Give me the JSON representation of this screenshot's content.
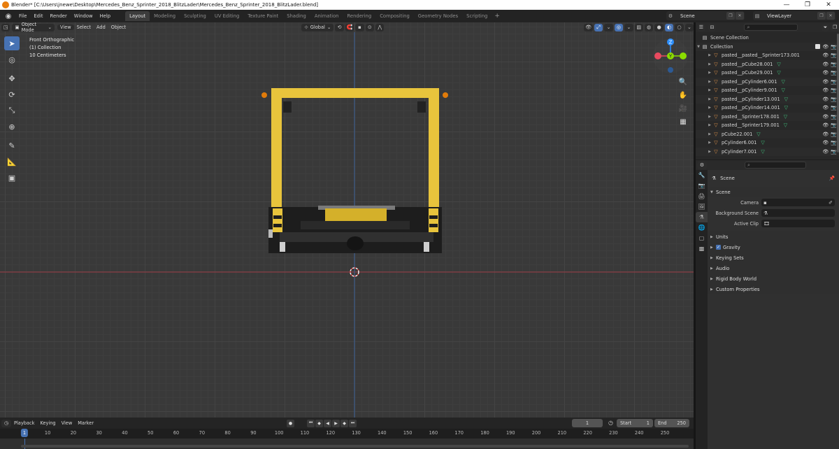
{
  "window": {
    "title": "Blender* [C:\\Users\\jnewe\\Desktop\\Mercedes_Benz_Sprinter_2018_BlitzLader\\Mercedes_Benz_Sprinter_2018_BlitzLader.blend]",
    "minimize": "—",
    "maximize": "❐",
    "close": "✕"
  },
  "menu": [
    "File",
    "Edit",
    "Render",
    "Window",
    "Help"
  ],
  "workspaces": [
    {
      "label": "Layout",
      "active": true
    },
    {
      "label": "Modeling",
      "active": false
    },
    {
      "label": "Sculpting",
      "active": false
    },
    {
      "label": "UV Editing",
      "active": false
    },
    {
      "label": "Texture Paint",
      "active": false
    },
    {
      "label": "Shading",
      "active": false
    },
    {
      "label": "Animation",
      "active": false
    },
    {
      "label": "Rendering",
      "active": false
    },
    {
      "label": "Compositing",
      "active": false
    },
    {
      "label": "Geometry Nodes",
      "active": false
    },
    {
      "label": "Scripting",
      "active": false
    }
  ],
  "workspace_add": "+",
  "scene_selector": {
    "value": "Scene"
  },
  "viewlayer_selector": {
    "value": "ViewLayer"
  },
  "viewport": {
    "mode": "Object Mode",
    "menus": [
      "View",
      "Select",
      "Add",
      "Object"
    ],
    "transform_orientation": "Global",
    "info_lines": [
      "Front Orthographic",
      "(1) Collection",
      "10 Centimeters"
    ],
    "gizmo_axes": {
      "x": "X",
      "y": "Y",
      "z": "Z"
    }
  },
  "outliner": {
    "search_placeholder": "",
    "scene_collection": "Scene Collection",
    "collection": "Collection",
    "items": [
      {
        "name": "pasted__pasted__Sprinter173.001",
        "modifier": false
      },
      {
        "name": "pasted__pCube28.001",
        "modifier": true
      },
      {
        "name": "pasted__pCube29.001",
        "modifier": true
      },
      {
        "name": "pasted__pCylinder6.001",
        "modifier": true
      },
      {
        "name": "pasted__pCylinder9.001",
        "modifier": true
      },
      {
        "name": "pasted__pCylinder13.001",
        "modifier": true
      },
      {
        "name": "pasted__pCylinder14.001",
        "modifier": true
      },
      {
        "name": "pasted__Sprinter178.001",
        "modifier": true
      },
      {
        "name": "pasted__Sprinter179.001",
        "modifier": true
      },
      {
        "name": "pCube22.001",
        "modifier": true
      },
      {
        "name": "pCylinder6.001",
        "modifier": true
      },
      {
        "name": "pCylinder7.001",
        "modifier": true
      }
    ]
  },
  "properties": {
    "breadcrumb": "Scene",
    "panel_scene": "Scene",
    "fields": [
      {
        "label": "Camera",
        "value": ""
      },
      {
        "label": "Background Scene",
        "value": ""
      },
      {
        "label": "Active Clip",
        "value": ""
      }
    ],
    "subpanels": [
      "Units",
      "Gravity",
      "Keying Sets",
      "Audio",
      "Rigid Body World",
      "Custom Properties"
    ],
    "gravity_enabled": true
  },
  "timeline": {
    "menus": [
      "Playback",
      "Keying",
      "View",
      "Marker"
    ],
    "current_frame": "1",
    "start_label": "Start",
    "start": "1",
    "end_label": "End",
    "end": "250",
    "ruler": [
      "1",
      "10",
      "20",
      "30",
      "40",
      "50",
      "60",
      "70",
      "80",
      "90",
      "100",
      "110",
      "120",
      "130",
      "140",
      "150",
      "160",
      "170",
      "180",
      "190",
      "200",
      "210",
      "220",
      "230",
      "240",
      "250"
    ]
  },
  "colors": {
    "accent": "#4772b3",
    "object_yellow": "#e8c43c",
    "x_axis": "#e84a5f",
    "y_axis": "#8bdc00",
    "z_axis": "#2c8fff"
  }
}
